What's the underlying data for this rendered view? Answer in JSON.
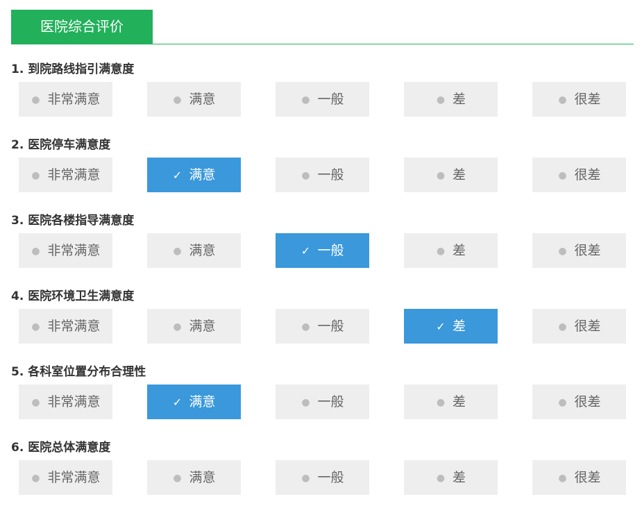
{
  "header": {
    "title": "医院综合评价"
  },
  "colors": {
    "accent": "#22b05b",
    "selected": "#3a98db",
    "option_bg": "#eeeeee"
  },
  "icons": {
    "unselected": "radio-dot-icon",
    "selected": "checkmark-icon"
  },
  "questions": [
    {
      "title": "1. 到院路线指引满意度",
      "options": [
        {
          "label": "非常满意",
          "mark": "●",
          "selected": false
        },
        {
          "label": "满意",
          "mark": "●",
          "selected": false
        },
        {
          "label": "一般",
          "mark": "●",
          "selected": false
        },
        {
          "label": "差",
          "mark": "●",
          "selected": false
        },
        {
          "label": "很差",
          "mark": "●",
          "selected": false
        }
      ]
    },
    {
      "title": "2. 医院停车满意度",
      "options": [
        {
          "label": "非常满意",
          "mark": "●",
          "selected": false
        },
        {
          "label": "满意",
          "mark": "✓",
          "selected": true
        },
        {
          "label": "一般",
          "mark": "●",
          "selected": false
        },
        {
          "label": "差",
          "mark": "●",
          "selected": false
        },
        {
          "label": "很差",
          "mark": "●",
          "selected": false
        }
      ]
    },
    {
      "title": "3. 医院各楼指导满意度",
      "options": [
        {
          "label": "非常满意",
          "mark": "●",
          "selected": false
        },
        {
          "label": "满意",
          "mark": "●",
          "selected": false
        },
        {
          "label": "一般",
          "mark": "✓",
          "selected": true
        },
        {
          "label": "差",
          "mark": "●",
          "selected": false
        },
        {
          "label": "很差",
          "mark": "●",
          "selected": false
        }
      ]
    },
    {
      "title": "4. 医院环境卫生满意度",
      "options": [
        {
          "label": "非常满意",
          "mark": "●",
          "selected": false
        },
        {
          "label": "满意",
          "mark": "●",
          "selected": false
        },
        {
          "label": "一般",
          "mark": "●",
          "selected": false
        },
        {
          "label": "差",
          "mark": "✓",
          "selected": true
        },
        {
          "label": "很差",
          "mark": "●",
          "selected": false
        }
      ]
    },
    {
      "title": "5. 各科室位置分布合理性",
      "options": [
        {
          "label": "非常满意",
          "mark": "●",
          "selected": false
        },
        {
          "label": "满意",
          "mark": "✓",
          "selected": true
        },
        {
          "label": "一般",
          "mark": "●",
          "selected": false
        },
        {
          "label": "差",
          "mark": "●",
          "selected": false
        },
        {
          "label": "很差",
          "mark": "●",
          "selected": false
        }
      ]
    },
    {
      "title": "6. 医院总体满意度",
      "options": [
        {
          "label": "非常满意",
          "mark": "●",
          "selected": false
        },
        {
          "label": "满意",
          "mark": "●",
          "selected": false
        },
        {
          "label": "一般",
          "mark": "●",
          "selected": false
        },
        {
          "label": "差",
          "mark": "●",
          "selected": false
        },
        {
          "label": "很差",
          "mark": "●",
          "selected": false
        }
      ]
    }
  ]
}
